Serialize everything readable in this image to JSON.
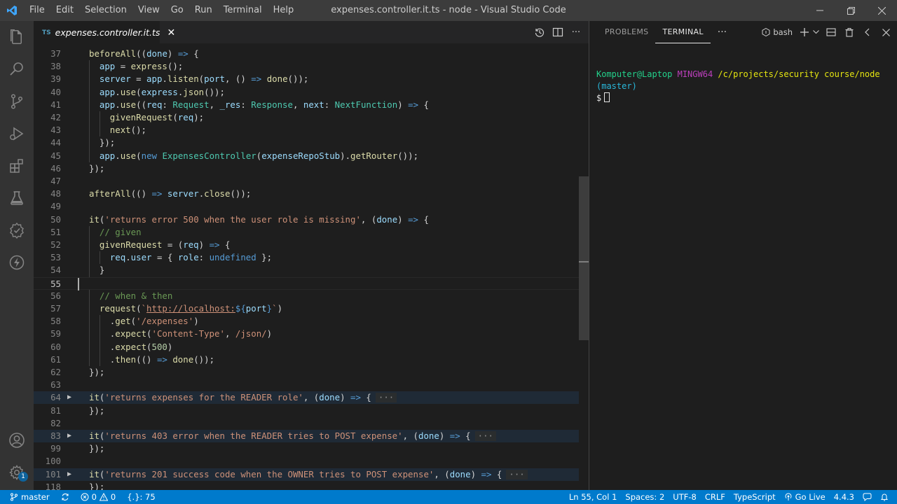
{
  "window": {
    "title": "expenses.controller.it.ts - node - Visual Studio Code",
    "menu": [
      "File",
      "Edit",
      "Selection",
      "View",
      "Go",
      "Run",
      "Terminal",
      "Help"
    ]
  },
  "activity_bar": {
    "icons": [
      "explorer-icon",
      "search-icon",
      "source-control-icon",
      "run-debug-icon",
      "extensions-icon",
      "testing-icon",
      "remote-explorer-icon",
      "live-share-icon",
      "account-icon",
      "settings-gear-icon"
    ],
    "settings_badge": "1"
  },
  "editor": {
    "tab": {
      "icon_text": "TS",
      "label": "expenses.controller.it.ts",
      "close": "✕"
    },
    "current_line": 55,
    "lines": [
      {
        "n": "37",
        "indent": 0,
        "tokens": [
          [
            "t-id",
            "beforeAll"
          ],
          [
            "t-p",
            "(("
          ],
          [
            "t-par",
            "done"
          ],
          [
            "t-p",
            ") "
          ],
          [
            "t-kw",
            "=>"
          ],
          [
            "t-p",
            " {"
          ]
        ]
      },
      {
        "n": "38",
        "indent": 1,
        "tokens": [
          [
            "t-var",
            "app"
          ],
          [
            "t-p",
            " = "
          ],
          [
            "t-id",
            "express"
          ],
          [
            "t-p",
            "();"
          ]
        ]
      },
      {
        "n": "39",
        "indent": 1,
        "tokens": [
          [
            "t-var",
            "server"
          ],
          [
            "t-p",
            " = "
          ],
          [
            "t-var",
            "app"
          ],
          [
            "t-p",
            "."
          ],
          [
            "t-id",
            "listen"
          ],
          [
            "t-p",
            "("
          ],
          [
            "t-var",
            "port"
          ],
          [
            "t-p",
            ", () "
          ],
          [
            "t-kw",
            "=>"
          ],
          [
            "t-p",
            " "
          ],
          [
            "t-id",
            "done"
          ],
          [
            "t-p",
            "());"
          ]
        ]
      },
      {
        "n": "40",
        "indent": 1,
        "tokens": [
          [
            "t-var",
            "app"
          ],
          [
            "t-p",
            "."
          ],
          [
            "t-id",
            "use"
          ],
          [
            "t-p",
            "("
          ],
          [
            "t-var",
            "express"
          ],
          [
            "t-p",
            "."
          ],
          [
            "t-id",
            "json"
          ],
          [
            "t-p",
            "());"
          ]
        ]
      },
      {
        "n": "41",
        "indent": 1,
        "tokens": [
          [
            "t-var",
            "app"
          ],
          [
            "t-p",
            "."
          ],
          [
            "t-id",
            "use"
          ],
          [
            "t-p",
            "(("
          ],
          [
            "t-par",
            "req"
          ],
          [
            "t-p",
            ": "
          ],
          [
            "t-type",
            "Request"
          ],
          [
            "t-p",
            ", "
          ],
          [
            "t-par",
            "_res"
          ],
          [
            "t-p",
            ": "
          ],
          [
            "t-type",
            "Response"
          ],
          [
            "t-p",
            ", "
          ],
          [
            "t-par",
            "next"
          ],
          [
            "t-p",
            ": "
          ],
          [
            "t-type",
            "NextFunction"
          ],
          [
            "t-p",
            ") "
          ],
          [
            "t-kw",
            "=>"
          ],
          [
            "t-p",
            " {"
          ]
        ]
      },
      {
        "n": "42",
        "indent": 2,
        "tokens": [
          [
            "t-id",
            "givenRequest"
          ],
          [
            "t-p",
            "("
          ],
          [
            "t-var",
            "req"
          ],
          [
            "t-p",
            ");"
          ]
        ]
      },
      {
        "n": "43",
        "indent": 2,
        "tokens": [
          [
            "t-id",
            "next"
          ],
          [
            "t-p",
            "();"
          ]
        ]
      },
      {
        "n": "44",
        "indent": 1,
        "tokens": [
          [
            "t-p",
            "});"
          ]
        ]
      },
      {
        "n": "45",
        "indent": 1,
        "tokens": [
          [
            "t-var",
            "app"
          ],
          [
            "t-p",
            "."
          ],
          [
            "t-id",
            "use"
          ],
          [
            "t-p",
            "("
          ],
          [
            "t-kw",
            "new"
          ],
          [
            "t-p",
            " "
          ],
          [
            "t-type",
            "ExpensesController"
          ],
          [
            "t-p",
            "("
          ],
          [
            "t-var",
            "expenseRepoStub"
          ],
          [
            "t-p",
            ")."
          ],
          [
            "t-id",
            "getRouter"
          ],
          [
            "t-p",
            "());"
          ]
        ]
      },
      {
        "n": "46",
        "indent": 0,
        "tokens": [
          [
            "t-p",
            "});"
          ]
        ]
      },
      {
        "n": "47",
        "indent": 0,
        "tokens": []
      },
      {
        "n": "48",
        "indent": 0,
        "tokens": [
          [
            "t-id",
            "afterAll"
          ],
          [
            "t-p",
            "(() "
          ],
          [
            "t-kw",
            "=>"
          ],
          [
            "t-p",
            " "
          ],
          [
            "t-var",
            "server"
          ],
          [
            "t-p",
            "."
          ],
          [
            "t-id",
            "close"
          ],
          [
            "t-p",
            "());"
          ]
        ]
      },
      {
        "n": "49",
        "indent": 0,
        "tokens": []
      },
      {
        "n": "50",
        "indent": 0,
        "tokens": [
          [
            "t-id",
            "it"
          ],
          [
            "t-p",
            "("
          ],
          [
            "t-str",
            "'returns error 500 when the user role is missing'"
          ],
          [
            "t-p",
            ", ("
          ],
          [
            "t-par",
            "done"
          ],
          [
            "t-p",
            ") "
          ],
          [
            "t-kw",
            "=>"
          ],
          [
            "t-p",
            " {"
          ]
        ]
      },
      {
        "n": "51",
        "indent": 1,
        "tokens": [
          [
            "t-com",
            "// given"
          ]
        ]
      },
      {
        "n": "52",
        "indent": 1,
        "tokens": [
          [
            "t-id",
            "givenRequest"
          ],
          [
            "t-p",
            " = ("
          ],
          [
            "t-par",
            "req"
          ],
          [
            "t-p",
            ") "
          ],
          [
            "t-kw",
            "=>"
          ],
          [
            "t-p",
            " {"
          ]
        ]
      },
      {
        "n": "53",
        "indent": 2,
        "tokens": [
          [
            "t-var",
            "req"
          ],
          [
            "t-p",
            "."
          ],
          [
            "t-var",
            "user"
          ],
          [
            "t-p",
            " = { "
          ],
          [
            "t-var",
            "role"
          ],
          [
            "t-p",
            ": "
          ],
          [
            "t-kw",
            "undefined"
          ],
          [
            "t-p",
            " };"
          ]
        ]
      },
      {
        "n": "54",
        "indent": 1,
        "tokens": [
          [
            "t-p",
            "}"
          ]
        ]
      },
      {
        "n": "55",
        "indent": 0,
        "tokens": []
      },
      {
        "n": "56",
        "indent": 1,
        "tokens": [
          [
            "t-com",
            "// when & then"
          ]
        ]
      },
      {
        "n": "57",
        "indent": 1,
        "tokens": [
          [
            "t-id",
            "request"
          ],
          [
            "t-p",
            "("
          ],
          [
            "t-str",
            "`"
          ],
          [
            "t-url",
            "http://localhost:"
          ],
          [
            "t-kw",
            "${"
          ],
          [
            "t-var",
            "port"
          ],
          [
            "t-kw",
            "}"
          ],
          [
            "t-str",
            "`"
          ],
          [
            "t-p",
            ")"
          ]
        ]
      },
      {
        "n": "58",
        "indent": 2,
        "tokens": [
          [
            "t-p",
            "."
          ],
          [
            "t-id",
            "get"
          ],
          [
            "t-p",
            "("
          ],
          [
            "t-str",
            "'/expenses'"
          ],
          [
            "t-p",
            ")"
          ]
        ]
      },
      {
        "n": "59",
        "indent": 2,
        "tokens": [
          [
            "t-p",
            "."
          ],
          [
            "t-id",
            "expect"
          ],
          [
            "t-p",
            "("
          ],
          [
            "t-str",
            "'Content-Type'"
          ],
          [
            "t-p",
            ", "
          ],
          [
            "t-str",
            "/json/"
          ],
          [
            "t-p",
            ")"
          ]
        ]
      },
      {
        "n": "60",
        "indent": 2,
        "tokens": [
          [
            "t-p",
            "."
          ],
          [
            "t-id",
            "expect"
          ],
          [
            "t-p",
            "("
          ],
          [
            "t-num",
            "500"
          ],
          [
            "t-p",
            ")"
          ]
        ]
      },
      {
        "n": "61",
        "indent": 2,
        "tokens": [
          [
            "t-p",
            "."
          ],
          [
            "t-id",
            "then"
          ],
          [
            "t-p",
            "(() "
          ],
          [
            "t-kw",
            "=>"
          ],
          [
            "t-p",
            " "
          ],
          [
            "t-id",
            "done"
          ],
          [
            "t-p",
            "());"
          ]
        ]
      },
      {
        "n": "62",
        "indent": 0,
        "tokens": [
          [
            "t-p",
            "});"
          ]
        ]
      },
      {
        "n": "63",
        "indent": 0,
        "tokens": []
      },
      {
        "n": "64",
        "indent": 0,
        "folded": true,
        "tokens": [
          [
            "t-id",
            "it"
          ],
          [
            "t-p",
            "("
          ],
          [
            "t-str",
            "'returns expenses for the READER role'"
          ],
          [
            "t-p",
            ", ("
          ],
          [
            "t-par",
            "done"
          ],
          [
            "t-p",
            ") "
          ],
          [
            "t-kw",
            "=>"
          ],
          [
            "t-p",
            " {"
          ]
        ]
      },
      {
        "n": "81",
        "indent": 0,
        "tokens": [
          [
            "t-p",
            "});"
          ]
        ]
      },
      {
        "n": "82",
        "indent": 0,
        "tokens": []
      },
      {
        "n": "83",
        "indent": 0,
        "folded": true,
        "tokens": [
          [
            "t-id",
            "it"
          ],
          [
            "t-p",
            "("
          ],
          [
            "t-str",
            "'returns 403 error when the READER tries to POST expense'"
          ],
          [
            "t-p",
            ", ("
          ],
          [
            "t-par",
            "done"
          ],
          [
            "t-p",
            ") "
          ],
          [
            "t-kw",
            "=>"
          ],
          [
            "t-p",
            " {"
          ]
        ]
      },
      {
        "n": "99",
        "indent": 0,
        "tokens": [
          [
            "t-p",
            "});"
          ]
        ]
      },
      {
        "n": "100",
        "indent": 0,
        "tokens": []
      },
      {
        "n": "101",
        "indent": 0,
        "folded": true,
        "tokens": [
          [
            "t-id",
            "it"
          ],
          [
            "t-p",
            "("
          ],
          [
            "t-str",
            "'returns 201 success code when the OWNER tries to POST expense'"
          ],
          [
            "t-p",
            ", ("
          ],
          [
            "t-par",
            "done"
          ],
          [
            "t-p",
            ") "
          ],
          [
            "t-kw",
            "=>"
          ],
          [
            "t-p",
            " {"
          ]
        ]
      },
      {
        "n": "118",
        "indent": 0,
        "tokens": [
          [
            "t-p",
            "});"
          ]
        ]
      }
    ],
    "fold_ellipsis": "···"
  },
  "panel": {
    "tabs": [
      "PROBLEMS",
      "TERMINAL"
    ],
    "active_tab": "TERMINAL",
    "more": "···",
    "shell": "bash",
    "terminal": {
      "user_host": "Komputer@Laptop",
      "system": "MINGW64",
      "path": "/c/projects/security course/node",
      "branch": "(master)",
      "prompt": "$"
    }
  },
  "status_bar": {
    "branch": "master",
    "errors": "0",
    "warnings": "0",
    "braces": "{.}: 75",
    "position": "Ln 55, Col 1",
    "spaces": "Spaces: 2",
    "encoding": "UTF-8",
    "eol": "CRLF",
    "language": "TypeScript",
    "go_live": "Go Live",
    "version": "4.4.3"
  },
  "colors": {
    "accent": "#007acc",
    "titlebar": "#3c3c3c",
    "activitybar": "#333333",
    "editor_bg": "#1e1e1e"
  }
}
